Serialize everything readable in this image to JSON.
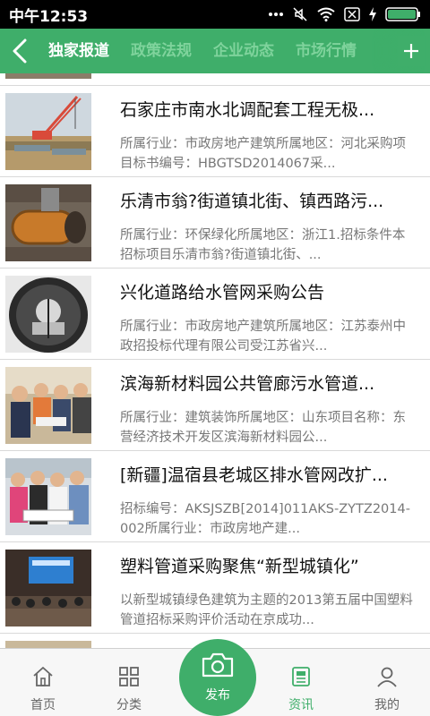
{
  "status_bar": {
    "time": "中午12:53",
    "signal_text": "..."
  },
  "header": {
    "tabs": [
      {
        "label": "独家报道",
        "active": true
      },
      {
        "label": "政策法规",
        "active": false
      },
      {
        "label": "企业动态",
        "active": false
      },
      {
        "label": "市场行情",
        "active": false
      }
    ],
    "accent_color": "#3fae6a"
  },
  "news": [
    {
      "title": "石家庄市南水北调配套工程无极...",
      "summary": "所属行业：市政房地产建筑所属地区：河北采购项目标书编号：HBGTSD2014067采..."
    },
    {
      "title": "乐清市翁?街道镇北街、镇西路污...",
      "summary": "所属行业：环保绿化所属地区：浙江1.招标条件本招标项目乐清市翁?街道镇北街、..."
    },
    {
      "title": "兴化道路给水管网采购公告",
      "summary": "所属行业：市政房地产建筑所属地区：江苏泰州中政招投标代理有限公司受江苏省兴..."
    },
    {
      "title": "滨海新材料园公共管廊污水管道...",
      "summary": "所属行业：建筑装饰所属地区：山东项目名称：东营经济技术开发区滨海新材料园公..."
    },
    {
      "title": "[新疆]温宿县老城区排水管网改扩...",
      "summary": "招标编号：AKSJSZB[2014]011AKS-ZYTZ2014-002所属行业：市政房地产建..."
    },
    {
      "title": "塑料管道采购聚焦“新型城镇化”",
      "summary": "以新型城镇绿色建筑为主题的2013第五届中国塑料管道招标采购评价活动在京成功..."
    }
  ],
  "bottom_nav": {
    "home": "首页",
    "category": "分类",
    "publish": "发布",
    "news": "资讯",
    "mine": "我的",
    "active": "资讯"
  }
}
